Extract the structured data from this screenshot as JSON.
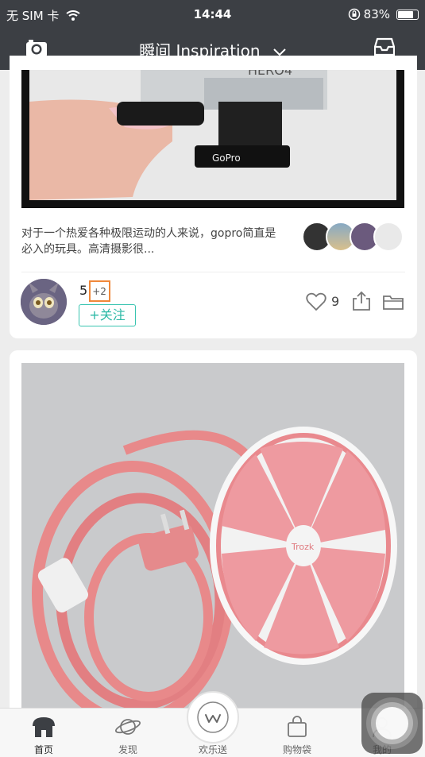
{
  "status_bar": {
    "carrier": "无 SIM 卡",
    "time": "14:44",
    "battery_pct": "83%",
    "battery_level": 0.83
  },
  "nav": {
    "title": "瞬间 Inspiration",
    "icons": [
      "camera-icon",
      "chevron-down-icon",
      "inbox-icon"
    ]
  },
  "post1": {
    "description": "对于一个热爱各种极限运动的人来说，gopro简直是必入的玩具。高清摄影很...",
    "count": "5",
    "extra": "+2",
    "follow_label": "+关注",
    "like_count": "9",
    "image_labels": [
      "HERO4",
      "GoPro"
    ]
  },
  "post2": {
    "image_labels": [
      "Trozk"
    ]
  },
  "tabs": [
    {
      "label": "首页",
      "icon": "home-icon",
      "active": true
    },
    {
      "label": "发现",
      "icon": "planet-icon",
      "active": false
    },
    {
      "label": "欢乐送",
      "icon": "w-logo-icon",
      "active": false
    },
    {
      "label": "购物袋",
      "icon": "bag-icon",
      "active": false
    },
    {
      "label": "我的",
      "icon": "user-icon",
      "active": false
    }
  ],
  "colors": {
    "nav_bg": "#3c3f44",
    "accent": "#2cb9a6",
    "highlight_box": "#f0883a"
  }
}
